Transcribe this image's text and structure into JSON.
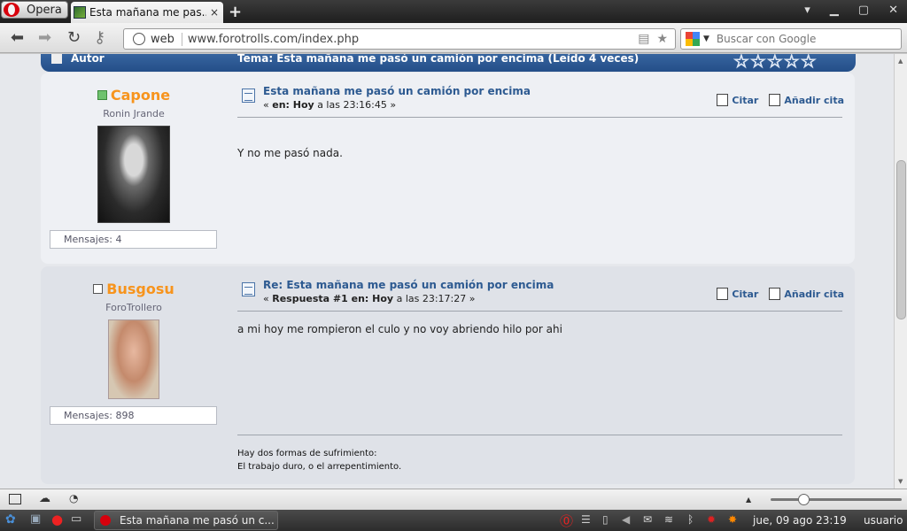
{
  "browser": {
    "menu_label": "Opera",
    "tab_title": "Esta mañana me pas...",
    "tab_close": "×",
    "new_tab": "+",
    "window_buttons": [
      "▾",
      "▁",
      "▢",
      "✕"
    ],
    "address_zone": "web",
    "url": "www.forotrolls.com/index.php",
    "search_placeholder": "Buscar con Google"
  },
  "topic_header": {
    "autor_label": "Autor",
    "tema_label": "Tema: Esta mañana me pasó un camión por encima  (Leído 4 veces)",
    "stars": "☆☆☆☆☆"
  },
  "posts": [
    {
      "username": "Capone",
      "online": true,
      "rank": "Ronin Jrande",
      "messages": "Mensajes: 4",
      "subject": "Esta mañana me pasó un camión por encima",
      "meta_prefix": "« ",
      "meta_bold": "en: Hoy",
      "meta_rest": " a las 23:16:45 »",
      "body": "Y no me pasó nada.",
      "quote": "Citar",
      "add_quote": "Añadir cita"
    },
    {
      "username": "Busgosu",
      "online": false,
      "rank": "ForoTrollero",
      "messages": "Mensajes: 898",
      "subject": "Re: Esta mañana me pasó un camión por encima",
      "meta_prefix": "« ",
      "meta_bold": "Respuesta #1 en: Hoy",
      "meta_rest": " a las 23:17:27 »",
      "body": "a mi hoy me rompieron el culo y no voy abriendo hilo por ahi",
      "quote": "Citar",
      "add_quote": "Añadir cita",
      "signature_line1": "Hay dos formas de sufrimiento:",
      "signature_line2": "El trabajo duro, o el arrepentimiento."
    }
  ],
  "zoom": 0.23,
  "taskbar": {
    "task_title": "Esta mañana me pasó un c...",
    "clock": "jue, 09 ago  23:19",
    "user": "usuario"
  }
}
